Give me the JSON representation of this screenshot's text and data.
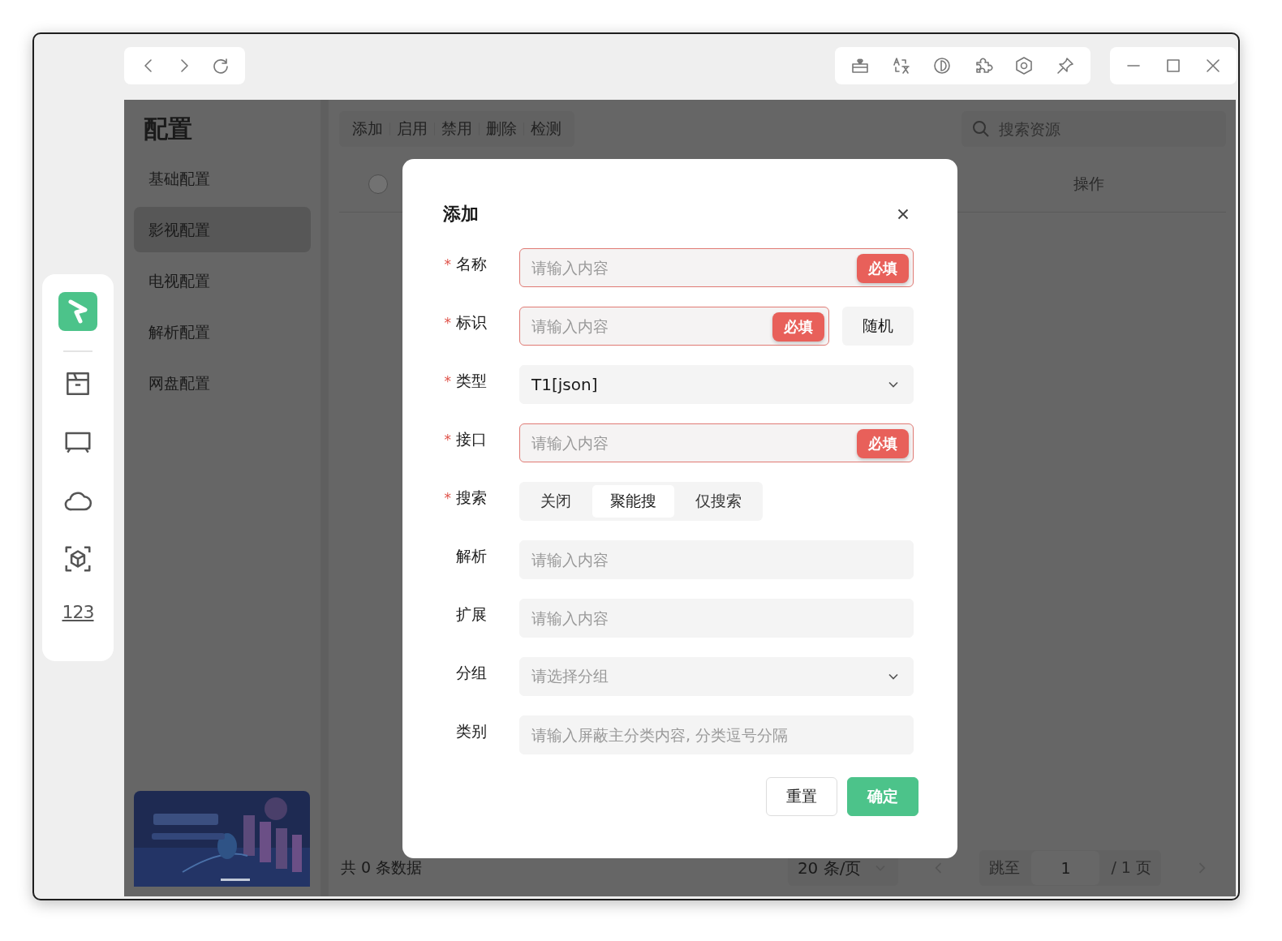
{
  "sidebar": {
    "title": "配置",
    "items": [
      {
        "label": "基础配置",
        "selected": false
      },
      {
        "label": "影视配置",
        "selected": true
      },
      {
        "label": "电视配置",
        "selected": false
      },
      {
        "label": "解析配置",
        "selected": false
      },
      {
        "label": "网盘配置",
        "selected": false
      }
    ]
  },
  "rail": {
    "number_label": "123"
  },
  "toolbar": {
    "buttons": [
      "添加",
      "启用",
      "禁用",
      "删除",
      "检测"
    ],
    "search": {
      "placeholder": "搜索资源"
    }
  },
  "table": {
    "select_all": {
      "checked": false
    },
    "columns": [
      "操作"
    ]
  },
  "footer": {
    "total": "共 0 条数据",
    "page_size": "20 条/页",
    "jump_label": "跳至",
    "page": "1",
    "page_count": "/ 1 页"
  },
  "dialog": {
    "title": "添加",
    "required_mark": "*",
    "fields": [
      {
        "label": "名称",
        "required": true,
        "kind": "input",
        "placeholder": "请输入内容",
        "invalid": true,
        "badge": "必填"
      },
      {
        "label": "标识",
        "required": true,
        "kind": "input",
        "placeholder": "请输入内容",
        "invalid": true,
        "badge": "必填",
        "button": "随机"
      },
      {
        "label": "类型",
        "required": true,
        "kind": "select",
        "value": "T1[json]"
      },
      {
        "label": "接口",
        "required": true,
        "kind": "input",
        "placeholder": "请输入内容",
        "invalid": true,
        "badge": "必填"
      },
      {
        "label": "搜索",
        "required": true,
        "kind": "segmented",
        "options": [
          {
            "label": "关闭",
            "selected": false
          },
          {
            "label": "聚能搜",
            "selected": true
          },
          {
            "label": "仅搜索",
            "selected": false
          }
        ]
      },
      {
        "label": "解析",
        "required": false,
        "kind": "input",
        "placeholder": "请输入内容",
        "invalid": false
      },
      {
        "label": "扩展",
        "required": false,
        "kind": "input",
        "placeholder": "请输入内容",
        "invalid": false
      },
      {
        "label": "分组",
        "required": false,
        "kind": "select",
        "placeholder": "请选择分组"
      },
      {
        "label": "类别",
        "required": false,
        "kind": "input",
        "placeholder": "请输入屏蔽主分类内容, 分类逗号分隔",
        "invalid": false
      }
    ],
    "buttons": [
      {
        "label": "重置",
        "kind": "default"
      },
      {
        "label": "确定",
        "kind": "primary"
      }
    ]
  }
}
